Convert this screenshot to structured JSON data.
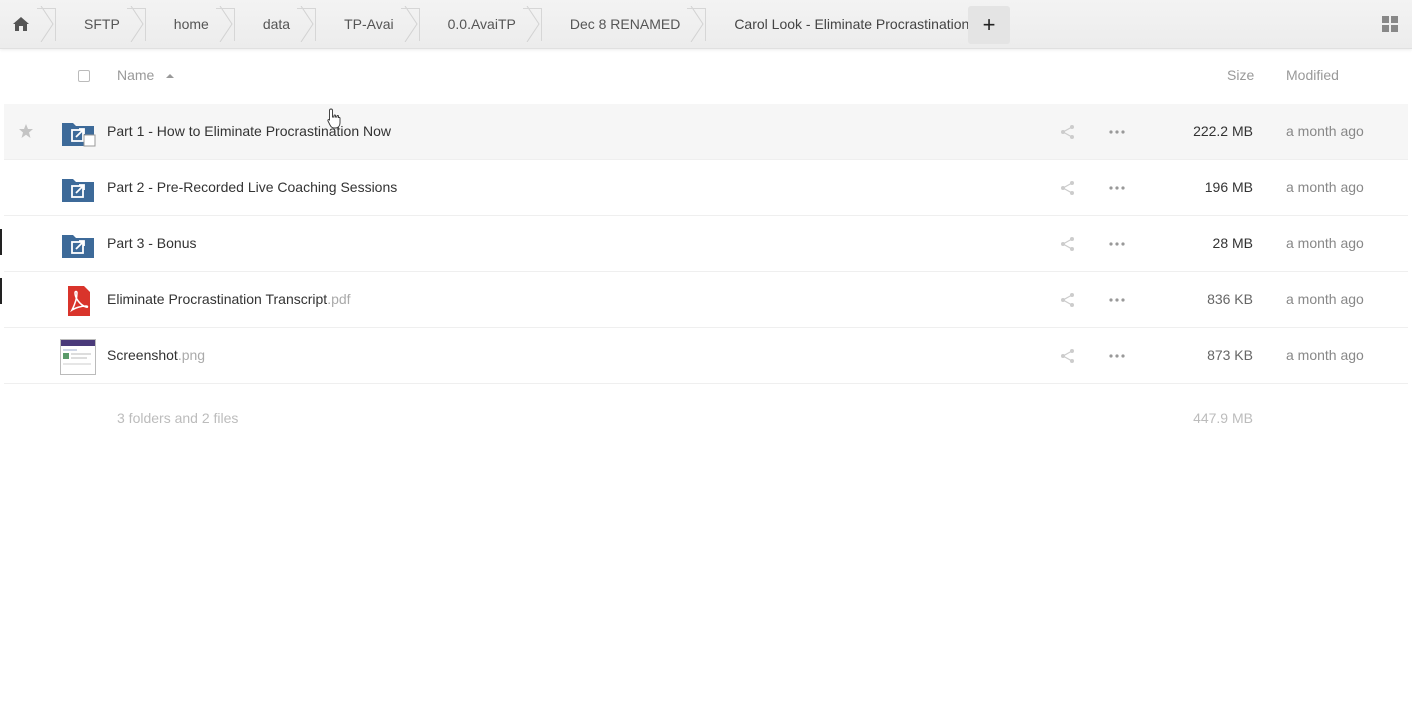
{
  "breadcrumb": {
    "home_icon": "home-icon",
    "items": [
      "SFTP",
      "home",
      "data",
      "TP-Avai",
      "0.0.AvaiTP",
      "Dec 8 RENAMED",
      "Carol Look - Eliminate Procrastination"
    ],
    "add_label": "+"
  },
  "header": {
    "name_label": "Name",
    "size_label": "Size",
    "modified_label": "Modified",
    "sort_icon": "sort-ascending-icon"
  },
  "files": [
    {
      "name": "Part 1 - How to Eliminate Procrastination Now",
      "ext": "",
      "type": "folder-shared",
      "size": "222.2 MB",
      "modified": "a month ago"
    },
    {
      "name": "Part 2 - Pre-Recorded Live Coaching Sessions",
      "ext": "",
      "type": "folder-shared",
      "size": "196 MB",
      "modified": "a month ago"
    },
    {
      "name": "Part 3 - Bonus",
      "ext": "",
      "type": "folder-shared",
      "size": "28 MB",
      "modified": "a month ago"
    },
    {
      "name": "Eliminate Procrastination Transcript",
      "ext": ".pdf",
      "type": "pdf",
      "size": "836 KB",
      "modified": "a month ago"
    },
    {
      "name": "Screenshot",
      "ext": ".png",
      "type": "image",
      "size": "873 KB",
      "modified": "a month ago"
    }
  ],
  "summary": {
    "count_text": "3 folders and 2 files",
    "total_size": "447.9 MB"
  },
  "colors": {
    "folder": "#3d6a99",
    "pdf": "#d9342b"
  }
}
